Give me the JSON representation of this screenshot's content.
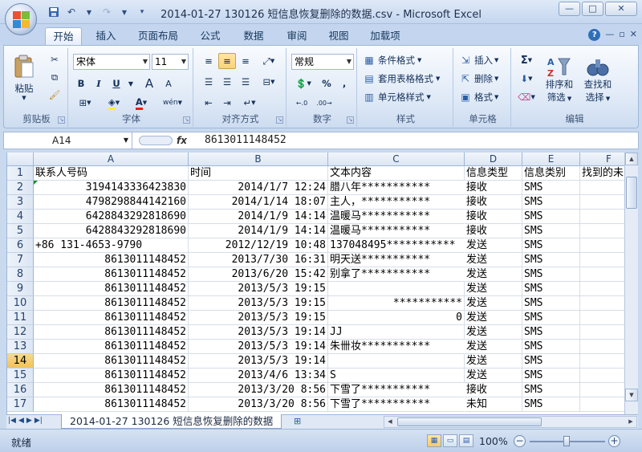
{
  "window": {
    "title": "2014-01-27 130126 短信息恢复删除的数据.csv - Microsoft Excel",
    "controls": [
      "—",
      "□",
      "✕"
    ]
  },
  "qat": {
    "icons": [
      "save-icon",
      "undo-icon",
      "redo-icon",
      "customize-icon"
    ]
  },
  "ribbon_tabs": [
    "开始",
    "插入",
    "页面布局",
    "公式",
    "数据",
    "审阅",
    "视图",
    "加载项"
  ],
  "ribbon": {
    "clipboard": {
      "label": "剪贴板",
      "paste": "粘贴"
    },
    "font": {
      "label": "字体",
      "name": "宋体",
      "size": "11",
      "bold": "B",
      "italic": "I",
      "underline": "U",
      "grow": "A",
      "shrink": "A",
      "pinyin": "wén"
    },
    "alignment": {
      "label": "对齐方式"
    },
    "number": {
      "label": "数字",
      "format": "常规",
      "percent": "%",
      "comma": ","
    },
    "styles": {
      "label": "样式",
      "conditional": "条件格式",
      "table": "套用表格格式",
      "cell": "单元格样式"
    },
    "cells": {
      "label": "单元格",
      "insert": "插入",
      "delete": "删除",
      "format": "格式"
    },
    "editing": {
      "label": "编辑",
      "sigma": "Σ",
      "sort": "排序和",
      "sort2": "筛选",
      "find": "查找和",
      "find2": "选择"
    }
  },
  "formula_bar": {
    "name_box": "A14",
    "fx": "fx",
    "value": "8613011148452"
  },
  "columns": [
    "A",
    "B",
    "C",
    "D",
    "E",
    "F"
  ],
  "rows": [
    {
      "n": "1",
      "a": "联系人号码",
      "b": "时间",
      "c": "文本内容",
      "d": "信息类型",
      "e": "信息类别",
      "f": "找到的未"
    },
    {
      "n": "2",
      "a": "3194143336423830",
      "b": "2014/1/7 12:24",
      "c": "腊八年***********",
      "d": "接收",
      "e": "SMS",
      "f": ""
    },
    {
      "n": "3",
      "a": "4798298844142160",
      "b": "2014/1/14 18:07",
      "c": "主人，***********",
      "d": "接收",
      "e": "SMS",
      "f": ""
    },
    {
      "n": "4",
      "a": "6428843292818690",
      "b": "2014/1/9 14:14",
      "c": "温暖马***********",
      "d": "接收",
      "e": "SMS",
      "f": ""
    },
    {
      "n": "5",
      "a": "6428843292818690",
      "b": "2014/1/9 14:14",
      "c": "温暖马***********",
      "d": "接收",
      "e": "SMS",
      "f": ""
    },
    {
      "n": "6",
      "a": "+86 131-4653-9790",
      "b": "2012/12/19 10:48",
      "c": "137048495***********",
      "d": "发送",
      "e": "SMS",
      "f": ""
    },
    {
      "n": "7",
      "a": "8613011148452",
      "b": "2013/7/30 16:31",
      "c": "明天送***********",
      "d": "发送",
      "e": "SMS",
      "f": ""
    },
    {
      "n": "8",
      "a": "8613011148452",
      "b": "2013/6/20 15:42",
      "c": "别拿了***********",
      "d": "发送",
      "e": "SMS",
      "f": ""
    },
    {
      "n": "9",
      "a": "8613011148452",
      "b": "2013/5/3 19:15",
      "c": "",
      "d": "发送",
      "e": "SMS",
      "f": ""
    },
    {
      "n": "10",
      "a": "8613011148452",
      "b": "2013/5/3 19:15",
      "c": "***********",
      "d": "发送",
      "e": "SMS",
      "f": ""
    },
    {
      "n": "11",
      "a": "8613011148452",
      "b": "2013/5/3 19:15",
      "c": "0",
      "d": "发送",
      "e": "SMS",
      "f": ""
    },
    {
      "n": "12",
      "a": "8613011148452",
      "b": "2013/5/3 19:14",
      "c": "JJ",
      "d": "发送",
      "e": "SMS",
      "f": ""
    },
    {
      "n": "13",
      "a": "8613011148452",
      "b": "2013/5/3 19:14",
      "c": "朱卌妆***********",
      "d": "发送",
      "e": "SMS",
      "f": ""
    },
    {
      "n": "14",
      "a": "8613011148452",
      "b": "2013/5/3 19:14",
      "c": "",
      "d": "发送",
      "e": "SMS",
      "f": ""
    },
    {
      "n": "15",
      "a": "8613011148452",
      "b": "2013/4/6 13:34",
      "c": "S",
      "d": "发送",
      "e": "SMS",
      "f": ""
    },
    {
      "n": "16",
      "a": "8613011148452",
      "b": "2013/3/20 8:56",
      "c": "下雪了***********",
      "d": "接收",
      "e": "SMS",
      "f": ""
    },
    {
      "n": "17",
      "a": "8613011148452",
      "b": "2013/3/20 8:56",
      "c": "下雪了***********",
      "d": "未知",
      "e": "SMS",
      "f": ""
    }
  ],
  "sheet_tab": "2014-01-27 130126 短信息恢复删除的数据",
  "status": {
    "text": "就绪",
    "zoom": "100%"
  }
}
